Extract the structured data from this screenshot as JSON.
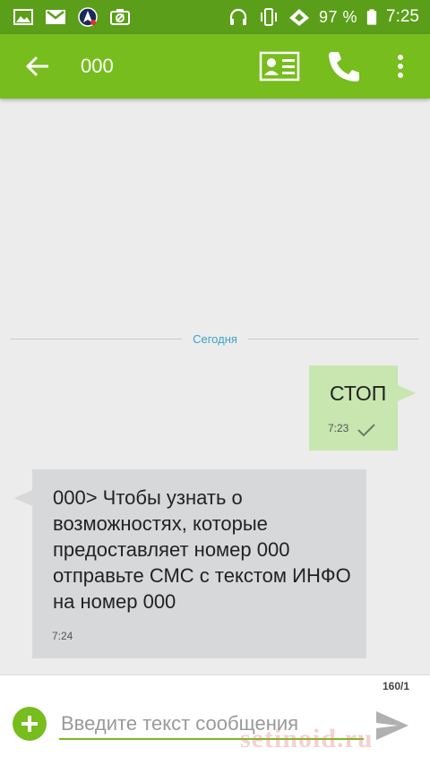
{
  "status_bar": {
    "battery_text": "97 %",
    "time": "7:25",
    "left_icons": [
      "image-icon",
      "gmail-icon",
      "navigation-app-icon",
      "camera-off-icon"
    ],
    "right_icons": [
      "headset-icon",
      "vibrate-icon",
      "signal-icon",
      "battery-icon"
    ]
  },
  "toolbar": {
    "title": "000",
    "icons": [
      "back-arrow-icon",
      "contact-card-icon",
      "phone-icon",
      "more-vert-icon"
    ]
  },
  "conversation": {
    "date_divider": "Сегодня",
    "messages": [
      {
        "direction": "outgoing",
        "text": "СТОП",
        "time": "7:23",
        "status": "check-icon"
      },
      {
        "direction": "incoming",
        "text": "000> Чтобы узнать о возможностях, которые предоставляет номер 000 отправьте СМС с текстом ИНФО на номер 000",
        "time": "7:24"
      }
    ]
  },
  "compose": {
    "counter": "160/1",
    "placeholder": "Введите текст сообщения",
    "value": "",
    "icons": [
      "add-circle-icon",
      "send-icon"
    ]
  },
  "watermark": "setinoid.ru",
  "colors": {
    "status_bar": "#5a9e19",
    "toolbar": "#76bd1d",
    "outgoing_bubble": "#c8e6b0",
    "incoming_bubble": "#d7d8da",
    "date_label": "#3aa2c9",
    "background": "#ececec"
  }
}
